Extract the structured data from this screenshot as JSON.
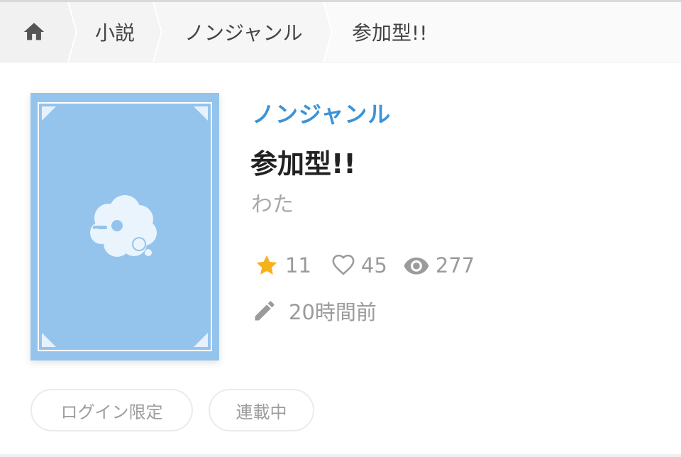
{
  "breadcrumb": {
    "home_icon": "home-icon",
    "items": [
      "小説",
      "ノンジャンル",
      "参加型!!"
    ]
  },
  "cover": {
    "icon": "thought-bubble-icon",
    "bg_color": "#94c4ec"
  },
  "work": {
    "genre": "ノンジャンル",
    "title": "参加型!!",
    "author": "わた",
    "stats": {
      "stars": "11",
      "likes": "45",
      "views": "277"
    },
    "updated": "20時間前"
  },
  "tags": [
    "ログイン限定",
    "連載中"
  ],
  "colors": {
    "genre": "#3d93d6",
    "star": "#f5b21b",
    "muted": "#9b9b9b"
  }
}
